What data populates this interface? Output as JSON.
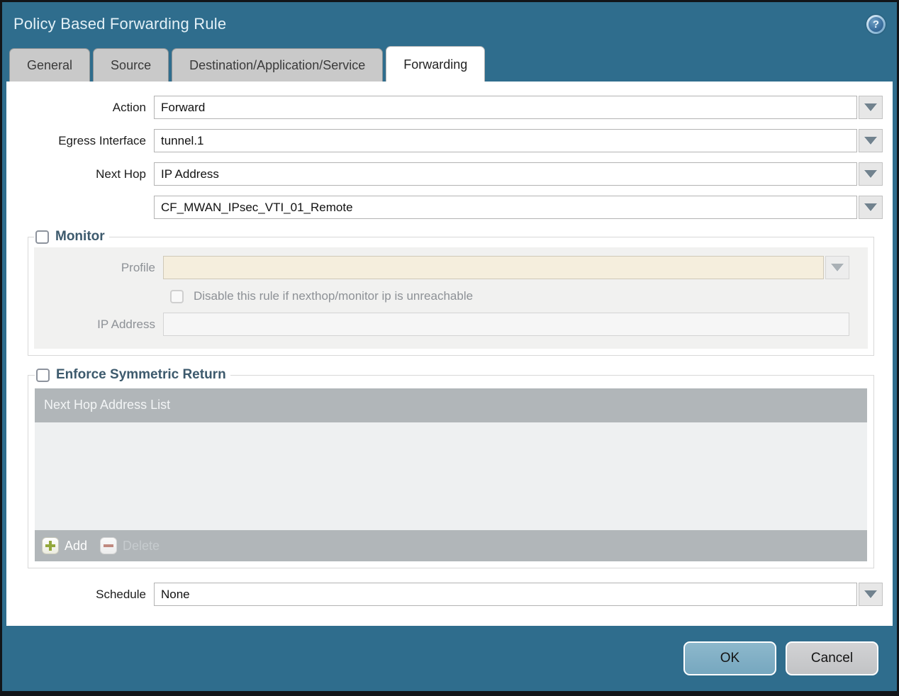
{
  "dialog": {
    "title": "Policy Based Forwarding Rule",
    "help_icon": "?"
  },
  "tabs": [
    {
      "label": "General",
      "active": false
    },
    {
      "label": "Source",
      "active": false
    },
    {
      "label": "Destination/Application/Service",
      "active": false
    },
    {
      "label": "Forwarding",
      "active": true
    }
  ],
  "form": {
    "action": {
      "label": "Action",
      "value": "Forward"
    },
    "egress_interface": {
      "label": "Egress Interface",
      "value": "tunnel.1"
    },
    "next_hop": {
      "label": "Next Hop",
      "value": "IP Address"
    },
    "next_hop_address": {
      "value": "CF_MWAN_IPsec_VTI_01_Remote"
    },
    "schedule": {
      "label": "Schedule",
      "value": "None"
    }
  },
  "monitor": {
    "title": "Monitor",
    "checked": false,
    "profile": {
      "label": "Profile",
      "value": ""
    },
    "disable_rule": {
      "label": "Disable this rule if nexthop/monitor ip is unreachable",
      "checked": false
    },
    "ip_address": {
      "label": "IP Address",
      "value": ""
    }
  },
  "enforce_symmetric_return": {
    "title": "Enforce Symmetric Return",
    "checked": false,
    "list_header": "Next Hop Address List",
    "rows": [],
    "add_button": "Add",
    "delete_button": "Delete"
  },
  "actions": {
    "ok": "OK",
    "cancel": "Cancel"
  },
  "colors": {
    "titlebar_bg": "#2f6d8d",
    "active_tab_bg": "#ffffff",
    "inactive_tab_bg": "#c9c9c9",
    "section_title_text": "#3d5a6d",
    "disabled_combo_bg": "#f5eedd",
    "table_bar_bg": "#b1b6b9",
    "ok_button_bg": "#7fb0c6",
    "cancel_button_bg": "#c9cacc",
    "add_plus_icon": "#93a83c",
    "delete_minus_icon": "#c08a80"
  }
}
